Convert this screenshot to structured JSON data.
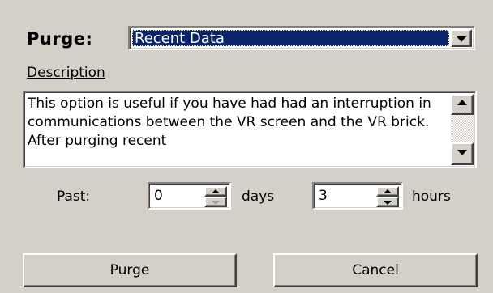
{
  "purge": {
    "label": "Purge:",
    "selected": "Recent Data"
  },
  "description": {
    "heading": "Description",
    "text": "This option is useful if you have had had an interruption in communications between the VR screen and the VR brick.   After purging recent"
  },
  "past": {
    "label": "Past:",
    "days_value": "0",
    "days_unit": "days",
    "hours_value": "3",
    "hours_unit": "hours"
  },
  "buttons": {
    "purge": "Purge",
    "cancel": "Cancel"
  },
  "icons": {
    "dropdown": "chevron-down-icon",
    "scroll_up": "scroll-up-icon",
    "scroll_down": "scroll-down-icon",
    "spin_up": "spin-up-icon",
    "spin_down": "spin-down-icon"
  },
  "colors": {
    "dialog_bg": "#d4d0c8",
    "selection_bg": "#0a246a",
    "selection_fg": "#ffffff"
  }
}
